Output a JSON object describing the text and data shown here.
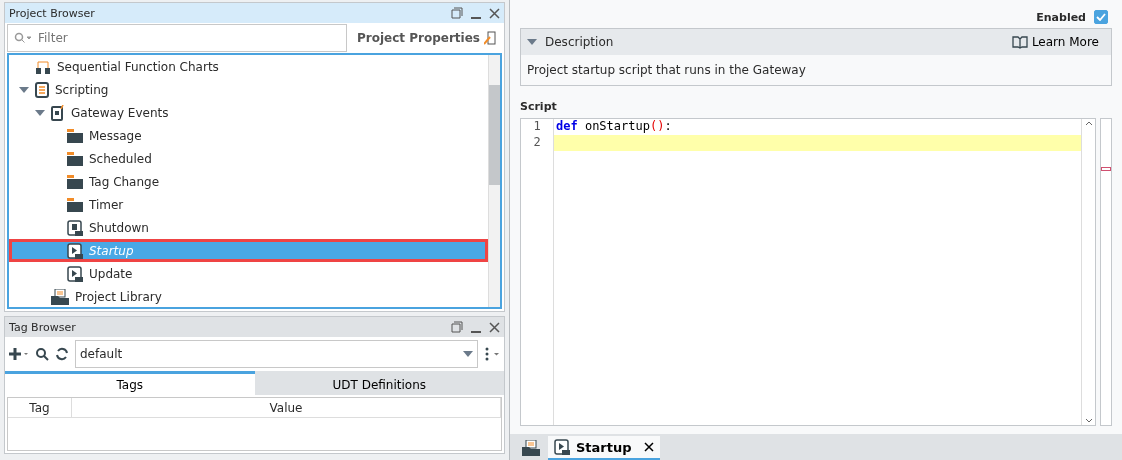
{
  "project_browser": {
    "title": "Project Browser",
    "filter": {
      "placeholder": "Filter"
    },
    "properties_button": "Project Properties",
    "tree": [
      {
        "label": "Sequential Function Charts",
        "kind": "chart",
        "selected": false
      },
      {
        "label": "Scripting",
        "kind": "script",
        "expanded": true,
        "selected": false,
        "children": [
          {
            "label": "Gateway Events",
            "kind": "events",
            "expanded": true,
            "selected": false,
            "children": [
              {
                "label": "Message",
                "kind": "folder",
                "selected": false
              },
              {
                "label": "Scheduled",
                "kind": "folder",
                "selected": false
              },
              {
                "label": "Tag Change",
                "kind": "folder",
                "selected": false
              },
              {
                "label": "Timer",
                "kind": "folder",
                "selected": false
              },
              {
                "label": "Shutdown",
                "kind": "stop",
                "selected": false
              },
              {
                "label": "Startup",
                "kind": "play",
                "selected": true
              },
              {
                "label": "Update",
                "kind": "play",
                "selected": false
              }
            ]
          },
          {
            "label": "Project Library",
            "kind": "library",
            "selected": false
          }
        ]
      }
    ]
  },
  "tag_browser": {
    "title": "Tag Browser",
    "provider": "default",
    "tabs": [
      {
        "label": "Tags",
        "selected": true
      },
      {
        "label": "UDT Definitions",
        "selected": false
      }
    ],
    "columns": [
      "Tag",
      "Value"
    ]
  },
  "editor": {
    "enabled": {
      "label": "Enabled",
      "checked": true
    },
    "description": {
      "title": "Description",
      "expanded": true,
      "learn_more": "Learn More",
      "text": "Project startup script that runs in the Gateway"
    },
    "script_label": "Script",
    "lines": [
      {
        "number": "1",
        "tokens": [
          {
            "text": "def",
            "kind": "keyword"
          },
          {
            "text": " onStartup",
            "kind": "plain"
          },
          {
            "text": "()",
            "kind": "paren"
          },
          {
            "text": ":",
            "kind": "plain"
          }
        ],
        "current": false
      },
      {
        "number": "2",
        "current": true
      }
    ]
  },
  "doc_tabs": [
    {
      "label": "Startup",
      "selected": true
    }
  ]
}
